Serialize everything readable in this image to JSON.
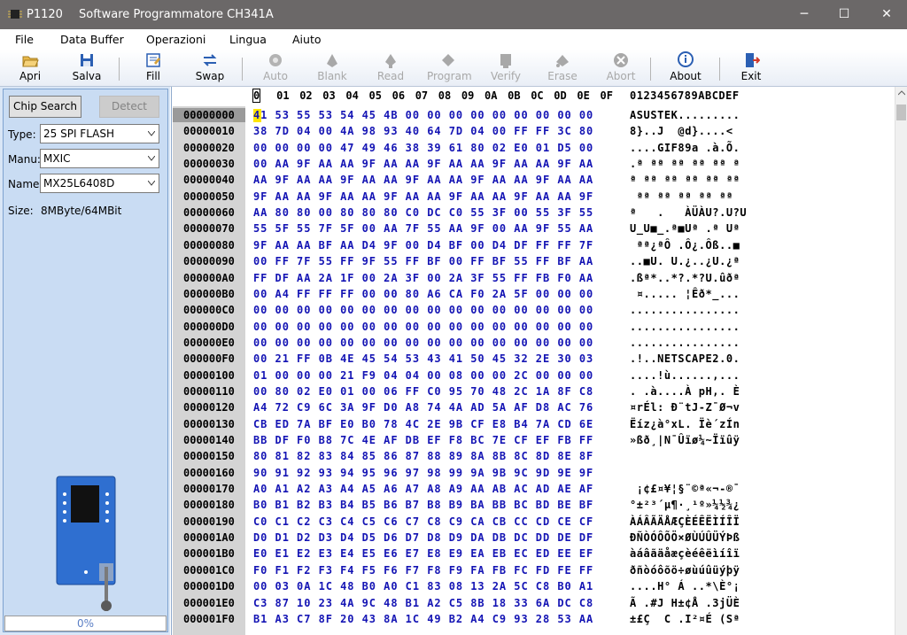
{
  "titlebar": {
    "app_name": "P1120",
    "title": "Software Programmatore CH341A",
    "minimize": "─",
    "maximize": "☐",
    "close": "✕"
  },
  "menu": [
    "File",
    "Data Buffer",
    "Operazioni",
    "Lingua",
    "Aiuto"
  ],
  "toolbar": [
    {
      "label": "Apri",
      "icon": "folder-open-icon",
      "enabled": true
    },
    {
      "label": "Salva",
      "icon": "floppy-disk-icon",
      "enabled": true
    },
    {
      "label": "Fill",
      "icon": "fill-icon",
      "enabled": true
    },
    {
      "label": "Swap",
      "icon": "swap-arrows-icon",
      "enabled": true
    },
    {
      "label": "Auto",
      "icon": "auto-gear-icon",
      "enabled": false
    },
    {
      "label": "Blank",
      "icon": "blank-chip-icon",
      "enabled": false
    },
    {
      "label": "Read",
      "icon": "read-chip-icon",
      "enabled": false
    },
    {
      "label": "Program",
      "icon": "program-chip-icon",
      "enabled": false
    },
    {
      "label": "Verify",
      "icon": "verify-chip-icon",
      "enabled": false
    },
    {
      "label": "Erase",
      "icon": "erase-chip-icon",
      "enabled": false
    },
    {
      "label": "Abort",
      "icon": "abort-x-icon",
      "enabled": false
    },
    {
      "label": "About",
      "icon": "info-icon",
      "enabled": true
    },
    {
      "label": "Exit",
      "icon": "exit-door-icon",
      "enabled": true
    }
  ],
  "left": {
    "chip_search": "Chip Search",
    "detect": "Detect",
    "type_label": "Type:",
    "type_value": "25 SPI FLASH",
    "manu_label": "Manu:",
    "manu_value": "MXIC",
    "name_label": "Name:",
    "name_value": "MX25L6408D",
    "size_label": "Size:",
    "size_value": "8MByte/64MBit",
    "progress": "0%"
  },
  "hex": {
    "columns": [
      "0",
      "01",
      "02",
      "03",
      "04",
      "05",
      "06",
      "07",
      "08",
      "09",
      "0A",
      "0B",
      "0C",
      "0D",
      "0E",
      "0F"
    ],
    "ascii_header": "0123456789ABCDEF",
    "rows": [
      {
        "addr": "00000000",
        "hex": "41 53 55 53 54 45 4B 00 00 00 00 00 00 00 00 00",
        "ascii": "ASUSTEK........."
      },
      {
        "addr": "00000010",
        "hex": "38 7D 04 00 4A 98 93 40 64 7D 04 00 FF FF 3C 80",
        "ascii": "8}..J  @d}....<"
      },
      {
        "addr": "00000020",
        "hex": "00 00 00 00 47 49 46 38 39 61 80 02 E0 01 D5 00",
        "ascii": "....GIF89a .à.Õ."
      },
      {
        "addr": "00000030",
        "hex": "00 AA 9F AA AA 9F AA AA 9F AA AA 9F AA AA 9F AA",
        "ascii": ".ª ªª ªª ªª ªª ª"
      },
      {
        "addr": "00000040",
        "hex": "AA 9F AA AA 9F AA AA 9F AA AA 9F AA AA 9F AA AA",
        "ascii": "ª ªª ªª ªª ªª ªª"
      },
      {
        "addr": "00000050",
        "hex": "9F AA AA 9F AA AA 9F AA AA 9F AA AA 9F AA AA 9F",
        "ascii": " ªª ªª ªª ªª ªª"
      },
      {
        "addr": "00000060",
        "hex": "AA 80 80 00 80 80 80 C0 DC C0 55 3F 00 55 3F 55",
        "ascii": "ª   .   ÀÜÀU?.U?U"
      },
      {
        "addr": "00000070",
        "hex": "55 5F 55 7F 5F 00 AA 7F 55 AA 9F 00 AA 9F 55 AA",
        "ascii": "U_U■_.ª■Uª .ª Uª"
      },
      {
        "addr": "00000080",
        "hex": "9F AA AA BF AA D4 9F 00 D4 BF 00 D4 DF FF FF 7F",
        "ascii": " ªª¿ªÔ .Ô¿.Ôß..■"
      },
      {
        "addr": "00000090",
        "hex": "00 FF 7F 55 FF 9F 55 FF BF 00 FF BF 55 FF BF AA",
        "ascii": "..■U. U.¿..¿U.¿ª"
      },
      {
        "addr": "000000A0",
        "hex": "FF DF AA 2A 1F 00 2A 3F 00 2A 3F 55 FF FB F0 AA",
        "ascii": ".ßª*..*?.*?U.ûðª"
      },
      {
        "addr": "000000B0",
        "hex": "00 A4 FF FF FF 00 00 80 A6 CA F0 2A 5F 00 00 00",
        "ascii": " ¤..... ¦Êð*_..."
      },
      {
        "addr": "000000C0",
        "hex": "00 00 00 00 00 00 00 00 00 00 00 00 00 00 00 00",
        "ascii": "................"
      },
      {
        "addr": "000000D0",
        "hex": "00 00 00 00 00 00 00 00 00 00 00 00 00 00 00 00",
        "ascii": "................"
      },
      {
        "addr": "000000E0",
        "hex": "00 00 00 00 00 00 00 00 00 00 00 00 00 00 00 00",
        "ascii": "................"
      },
      {
        "addr": "000000F0",
        "hex": "00 21 FF 0B 4E 45 54 53 43 41 50 45 32 2E 30 03",
        "ascii": ".!..NETSCAPE2.0."
      },
      {
        "addr": "00000100",
        "hex": "01 00 00 00 21 F9 04 04 00 08 00 00 2C 00 00 00",
        "ascii": "....!ù......,..."
      },
      {
        "addr": "00000110",
        "hex": "00 80 02 E0 01 00 06 FF C0 95 70 48 2C 1A 8F C8",
        "ascii": ". .à....À pH,. È"
      },
      {
        "addr": "00000120",
        "hex": "A4 72 C9 6C 3A 9F D0 A8 74 4A AD 5A AF D8 AC 76",
        "ascii": "¤rÉl: Ð¨tJ-Z¯Ø¬v"
      },
      {
        "addr": "00000130",
        "hex": "CB ED 7A BF E0 B0 78 4C 2E 9B CF E8 B4 7A CD 6E",
        "ascii": "Ëíz¿à°xL. Ïè´zÍn"
      },
      {
        "addr": "00000140",
        "hex": "BB DF F0 B8 7C 4E AF DB EF F8 BC 7E CF EF FB FF",
        "ascii": "»ßð¸|N¯Ûïø¼~Ïïûÿ"
      },
      {
        "addr": "00000150",
        "hex": "80 81 82 83 84 85 86 87 88 89 8A 8B 8C 8D 8E 8F",
        "ascii": ""
      },
      {
        "addr": "00000160",
        "hex": "90 91 92 93 94 95 96 97 98 99 9A 9B 9C 9D 9E 9F",
        "ascii": ""
      },
      {
        "addr": "00000170",
        "hex": "A0 A1 A2 A3 A4 A5 A6 A7 A8 A9 AA AB AC AD AE AF",
        "ascii": " ¡¢£¤¥¦§¨©ª«¬-®¯"
      },
      {
        "addr": "00000180",
        "hex": "B0 B1 B2 B3 B4 B5 B6 B7 B8 B9 BA BB BC BD BE BF",
        "ascii": "°±²³´µ¶·¸¹º»¼½¾¿"
      },
      {
        "addr": "00000190",
        "hex": "C0 C1 C2 C3 C4 C5 C6 C7 C8 C9 CA CB CC CD CE CF",
        "ascii": "ÀÁÂÃÄÅÆÇÈÉÊËÌÍÎÏ"
      },
      {
        "addr": "000001A0",
        "hex": "D0 D1 D2 D3 D4 D5 D6 D7 D8 D9 DA DB DC DD DE DF",
        "ascii": "ÐÑÒÓÔÕÖ×ØÙÚÛÜÝÞß"
      },
      {
        "addr": "000001B0",
        "hex": "E0 E1 E2 E3 E4 E5 E6 E7 E8 E9 EA EB EC ED EE EF",
        "ascii": "àáâãäåæçèéêëìíîï"
      },
      {
        "addr": "000001C0",
        "hex": "F0 F1 F2 F3 F4 F5 F6 F7 F8 F9 FA FB FC FD FE FF",
        "ascii": "ðñòóôõö÷øùúûüýþÿ"
      },
      {
        "addr": "000001D0",
        "hex": "00 03 0A 1C 48 B0 A0 C1 83 08 13 2A 5C C8 B0 A1",
        "ascii": "....H° Á ..*\\È°¡"
      },
      {
        "addr": "000001E0",
        "hex": "C3 87 10 23 4A 9C 48 B1 A2 C5 8B 18 33 6A DC C8",
        "ascii": "Ã .#J H±¢Å .3jÜÈ"
      },
      {
        "addr": "000001F0",
        "hex": "B1 A3 C7 8F 20 43 8A 1C 49 B2 A4 C9 93 28 53 AA",
        "ascii": "±£Ç  C .I²¤É (Sª"
      }
    ]
  },
  "colors": {
    "titlebar": "#6b6868",
    "hex_text": "#1414b4",
    "panel_bg": "#c9dcf3",
    "cursor": "#ffe500"
  }
}
